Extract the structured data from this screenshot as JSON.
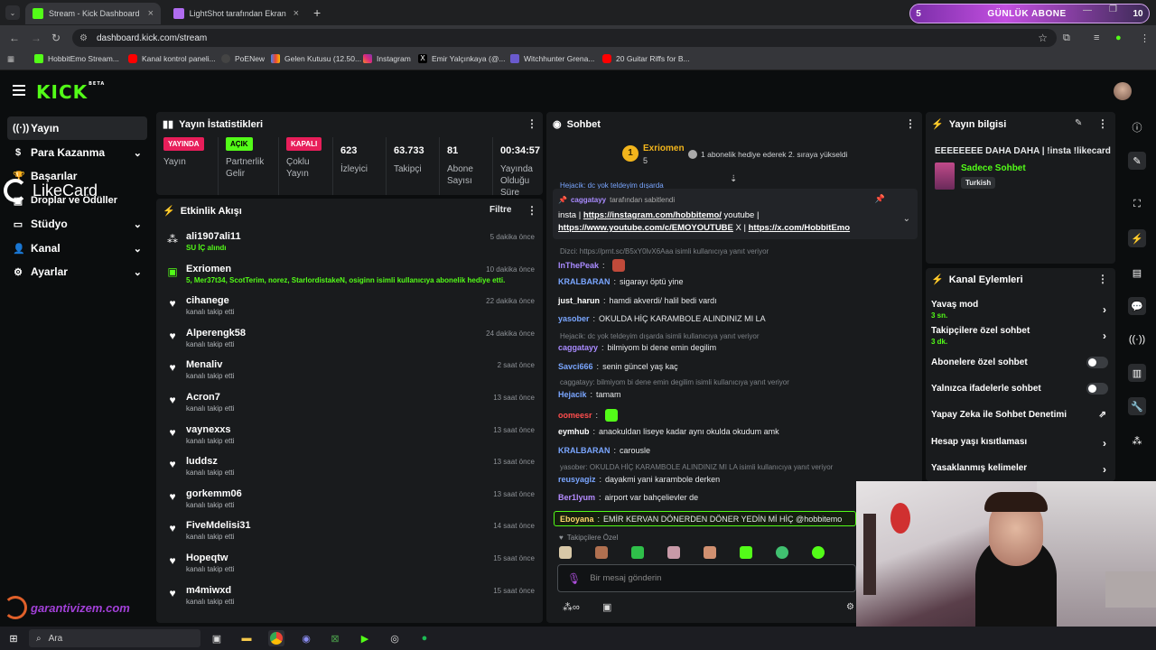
{
  "browser": {
    "tabs": [
      {
        "title": "Stream - Kick Dashboard",
        "active": true
      },
      {
        "title": "LightShot tarafından Ekran Gör",
        "active": false
      }
    ],
    "url": "dashboard.kick.com/stream",
    "bookmarks": [
      "HobbitEmo Stream...",
      "Kanal kontrol paneli...",
      "PoENew",
      "Gelen Kutusu (12.50...",
      "Instagram",
      "Emir Yalçınkaya (@...",
      "Witchhunter Grena...",
      "20 Guitar Riffs for B..."
    ]
  },
  "sub_banner": {
    "left": "5",
    "label": "GÜNLÜK ABONE",
    "right": "10"
  },
  "sidebar": {
    "items": [
      {
        "label": "Yayın",
        "icon": "broadcast-icon"
      },
      {
        "label": "Para Kazanma",
        "icon": "dollar-icon"
      },
      {
        "label": "Başarılar",
        "icon": "trophy-icon"
      },
      {
        "label": "Droplar ve Ödüller",
        "icon": "gift-icon"
      },
      {
        "label": "Stüdyo",
        "icon": "studio-icon"
      },
      {
        "label": "Kanal",
        "icon": "user-icon"
      },
      {
        "label": "Ayarlar",
        "icon": "gear-icon"
      }
    ]
  },
  "overlay": {
    "likecard": "LikeCard",
    "garanti": "garantivizem.com"
  },
  "stats": {
    "title": "Yayın İstatistikleri",
    "cells": [
      {
        "badge": "YAYINDA",
        "label": "Yayın",
        "color": "#e81e5a"
      },
      {
        "badge": "AÇIK",
        "label": "Partnerlik Gelir",
        "color": "#53fc18"
      },
      {
        "badge": "KAPALI",
        "label": "Çoklu Yayın",
        "color": "#e81e5a"
      },
      {
        "value": "623",
        "label": "İzleyici"
      },
      {
        "value": "63.733",
        "label": "Takipçi"
      },
      {
        "value": "81",
        "label": "Abone Sayısı"
      },
      {
        "value": "00:34:57",
        "label": "Yayında Olduğu Süre"
      }
    ]
  },
  "activity": {
    "title": "Etkinlik Akışı",
    "filter": "Filtre",
    "items": [
      {
        "name": "ali1907ali11",
        "sub": "SU İÇ alındı",
        "time": "5 dakika önce",
        "icon": "points-icon"
      },
      {
        "name": "Exriomen",
        "sub": "5, Mer37t34, ScotTerim, norez, StarlordistakeN, osiginn isimli kullanıcıya abonelik hediye etti.",
        "time": "10 dakika önce",
        "icon": "gift-icon"
      },
      {
        "name": "cihanege",
        "sub": "kanalı takip etti",
        "time": "22 dakika önce",
        "icon": "heart-icon"
      },
      {
        "name": "Alperengk58",
        "sub": "kanalı takip etti",
        "time": "24 dakika önce",
        "icon": "heart-icon"
      },
      {
        "name": "Menaliv",
        "sub": "kanalı takip etti",
        "time": "2 saat önce",
        "icon": "heart-icon"
      },
      {
        "name": "Acron7",
        "sub": "kanalı takip etti",
        "time": "13 saat önce",
        "icon": "heart-icon"
      },
      {
        "name": "vaynexxs",
        "sub": "kanalı takip etti",
        "time": "13 saat önce",
        "icon": "heart-icon"
      },
      {
        "name": "luddsz",
        "sub": "kanalı takip etti",
        "time": "13 saat önce",
        "icon": "heart-icon"
      },
      {
        "name": "gorkemm06",
        "sub": "kanalı takip etti",
        "time": "13 saat önce",
        "icon": "heart-icon"
      },
      {
        "name": "FiveMdelisi31",
        "sub": "kanalı takip etti",
        "time": "14 saat önce",
        "icon": "heart-icon"
      },
      {
        "name": "Hopeqtw",
        "sub": "kanalı takip etti",
        "time": "15 saat önce",
        "icon": "heart-icon"
      },
      {
        "name": "m4miwxd",
        "sub": "kanalı takip etti",
        "time": "15 saat önce",
        "icon": "heart-icon"
      }
    ]
  },
  "chat": {
    "title": "Sohbet",
    "top_gifter": {
      "rank": "1",
      "name": "Exriomen",
      "count": "5"
    },
    "gift_note": "1 abonelik hediye ederek 2. sıraya yükseldi",
    "pinned": {
      "cut_line": "Hejacik: dc yok teldeyim dışarda",
      "by": "caggatayy",
      "by_suffix": "tarafından sabitlendi",
      "line1_prefix": "insta | ",
      "link1": "https://instagram.com/hobbitemo/",
      "line1_suffix": " youtube |",
      "link2": "https://www.youtube.com/c/EMOYOUTUBE",
      "mid": " X | ",
      "link3": "https://x.com/HobbitEmo"
    },
    "messages": [
      {
        "type": "reply",
        "text": "Dizci: https://prnt.sc/B5xY0lvX6Aaa isimli kullanıcıya yanıt veriyor"
      },
      {
        "user": "InThePeak",
        "color": "#a98bff",
        "text": ""
      },
      {
        "user": "KRALBARAN",
        "color": "#7aa6ff",
        "text": "sigarayı öptü yine"
      },
      {
        "user": "just_harun",
        "color": "#ffffff",
        "text": "hamdi akverdi/ halil bedi vardı"
      },
      {
        "user": "yasober",
        "color": "#7aa6ff",
        "text": "OKULDA HİÇ KARAMBOLE ALINDINIZ MI LA"
      },
      {
        "type": "reply",
        "text": "Hejacik: dc yok teldeyim dışarda isimli kullanıcıya yanıt veriyor"
      },
      {
        "user": "caggatayy",
        "color": "#a98bff",
        "text": "bilmiyom bi dene emin degilim"
      },
      {
        "user": "Savci666",
        "color": "#7aa6ff",
        "text": "senin güncel yaş kaç"
      },
      {
        "type": "reply",
        "text": "caggatayy: bilmiyom bi dene emin degilim isimli kullanıcıya yanıt veriyor"
      },
      {
        "user": "Hejacik",
        "color": "#7aa6ff",
        "text": "tamam"
      },
      {
        "user": "oomeesr",
        "color": "#ff4d4d",
        "text": ""
      },
      {
        "user": "eymhub",
        "color": "#ffffff",
        "text": "anaokuldan liseye kadar aynı okulda okudum amk"
      },
      {
        "user": "KRALBARAN",
        "color": "#7aa6ff",
        "text": "carousle"
      },
      {
        "type": "reply",
        "text": "yasober: OKULDA HİÇ KARAMBOLE ALINDINIZ MI LA isimli kullanıcıya yanıt veriyor"
      },
      {
        "user": "reusyagiz",
        "color": "#7aa6ff",
        "text": "dayakmi yani karambole derken"
      },
      {
        "user": "Ber1lyum",
        "color": "#b58cff",
        "text": "airport var bahçelievler de"
      },
      {
        "user": "Eboyana",
        "color": "#ffd86b",
        "text": "EMİR KERVAN DÖNERDEN DÖNER YEDİN Mİ HİÇ @hobbitemo",
        "highlight": true
      }
    ],
    "follower_only": "Takipçilere Özel",
    "input_placeholder": "Bir mesaj gönderin"
  },
  "stream_info": {
    "title": "Yayın bilgisi",
    "stream_title": "EEEEEEEE DAHA DAHA | !insta !likecard",
    "category": "Sadece Sohbet",
    "language": "Turkish"
  },
  "channel_actions": {
    "title": "Kanal Eylemleri",
    "items": [
      {
        "label": "Yavaş mod",
        "sub": "3 sn.",
        "control": "arrow"
      },
      {
        "label": "Takipçilere özel sohbet",
        "sub": "3 dk.",
        "control": "arrow"
      },
      {
        "label": "Abonelere özel sohbet",
        "control": "toggle"
      },
      {
        "label": "Yalnızca ifadelerle sohbet",
        "control": "toggle"
      },
      {
        "label": "Yapay Zeka ile Sohbet Denetimi",
        "control": "external"
      },
      {
        "label": "Hesap yaşı kısıtlaması",
        "control": "arrow"
      },
      {
        "label": "Yasaklanmış kelimeler",
        "control": "arrow"
      }
    ]
  },
  "taskbar": {
    "search": "Ara"
  },
  "colors": {
    "kick_green": "#53fc18",
    "live_red": "#e81e5a"
  }
}
